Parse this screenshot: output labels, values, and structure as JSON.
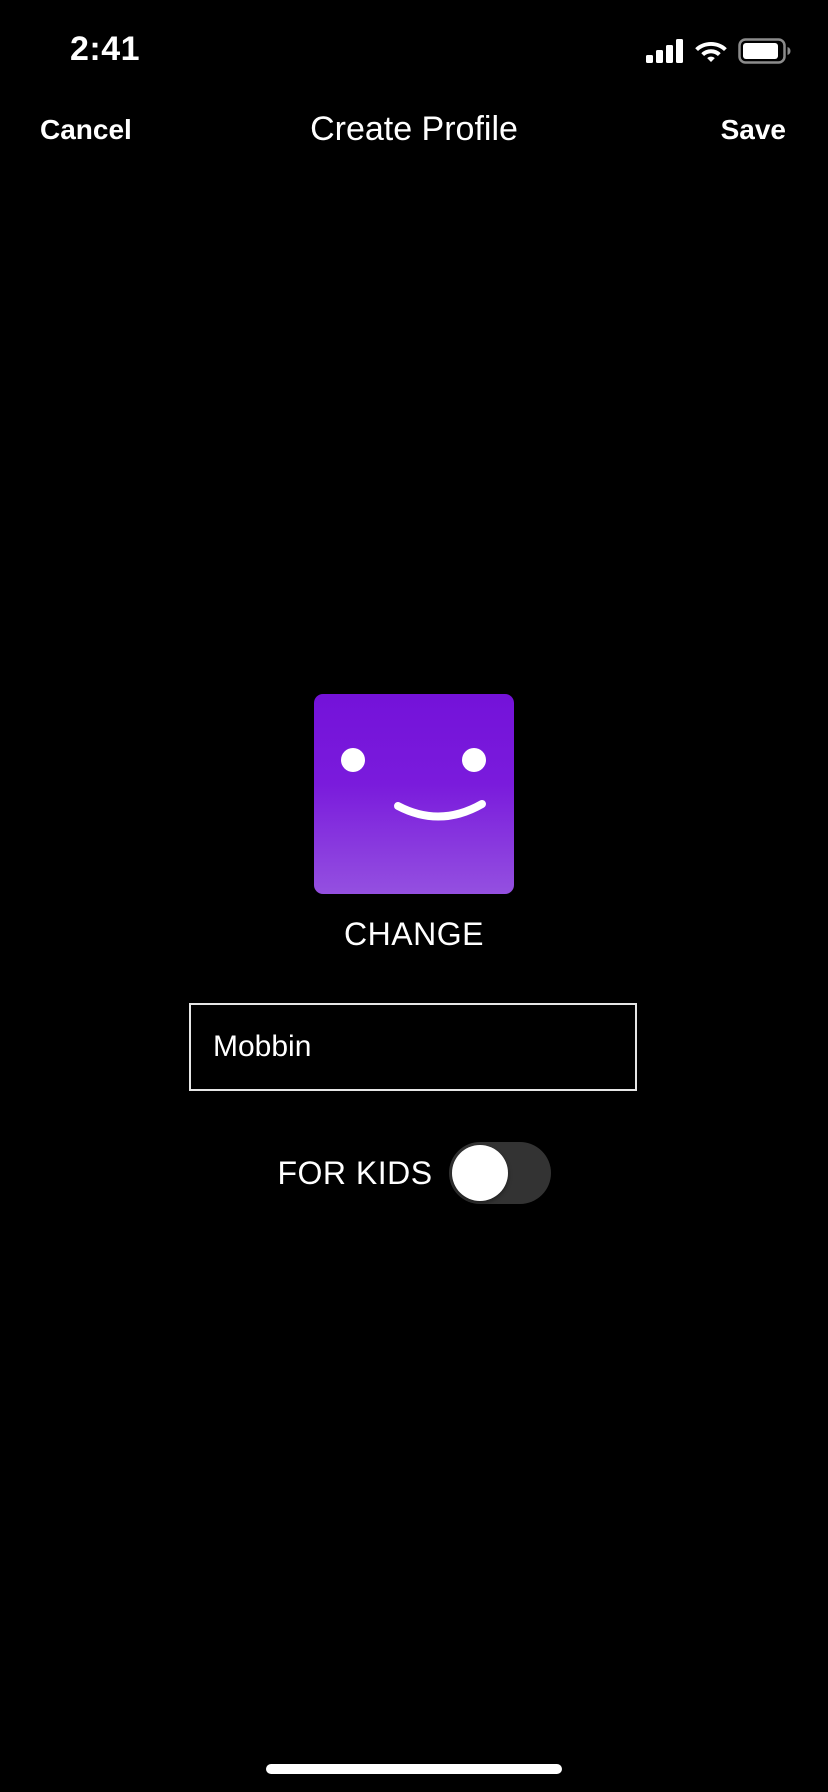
{
  "status_bar": {
    "time": "2:41",
    "icons": [
      "cellular-signal-icon",
      "wifi-icon",
      "battery-icon"
    ]
  },
  "nav": {
    "cancel_label": "Cancel",
    "title": "Create Profile",
    "save_label": "Save"
  },
  "profile": {
    "avatar_icon": "smiley-face-avatar-icon",
    "avatar_colors": [
      "#7412d9",
      "#9450e0"
    ],
    "change_label": "CHANGE",
    "name_value": "Mobbin",
    "name_placeholder": ""
  },
  "kids": {
    "label": "FOR KIDS",
    "enabled": false
  }
}
